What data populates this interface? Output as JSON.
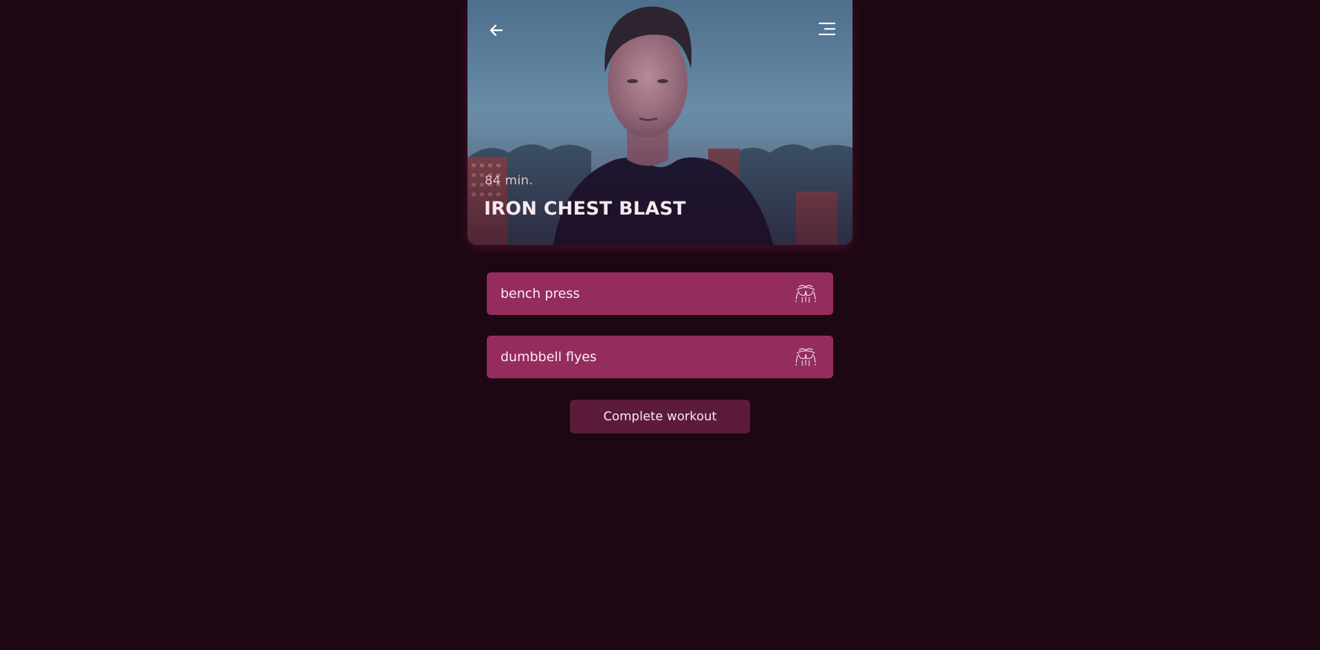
{
  "workout": {
    "duration": "84 min.",
    "title": "IRON CHEST BLAST"
  },
  "nav": {
    "back_icon": "arrow-left-icon",
    "menu_icon": "menu-icon"
  },
  "exercises": [
    {
      "label": "bench press",
      "icon": "chest-muscle-icon"
    },
    {
      "label": "dumbbell flyes",
      "icon": "chest-muscle-icon"
    }
  ],
  "actions": {
    "complete_label": "Complete workout"
  },
  "colors": {
    "background": "#1c0713",
    "exercise_card": "#952c5e",
    "complete_button": "#5c1b3a",
    "text_light": "#f7e9ee"
  }
}
